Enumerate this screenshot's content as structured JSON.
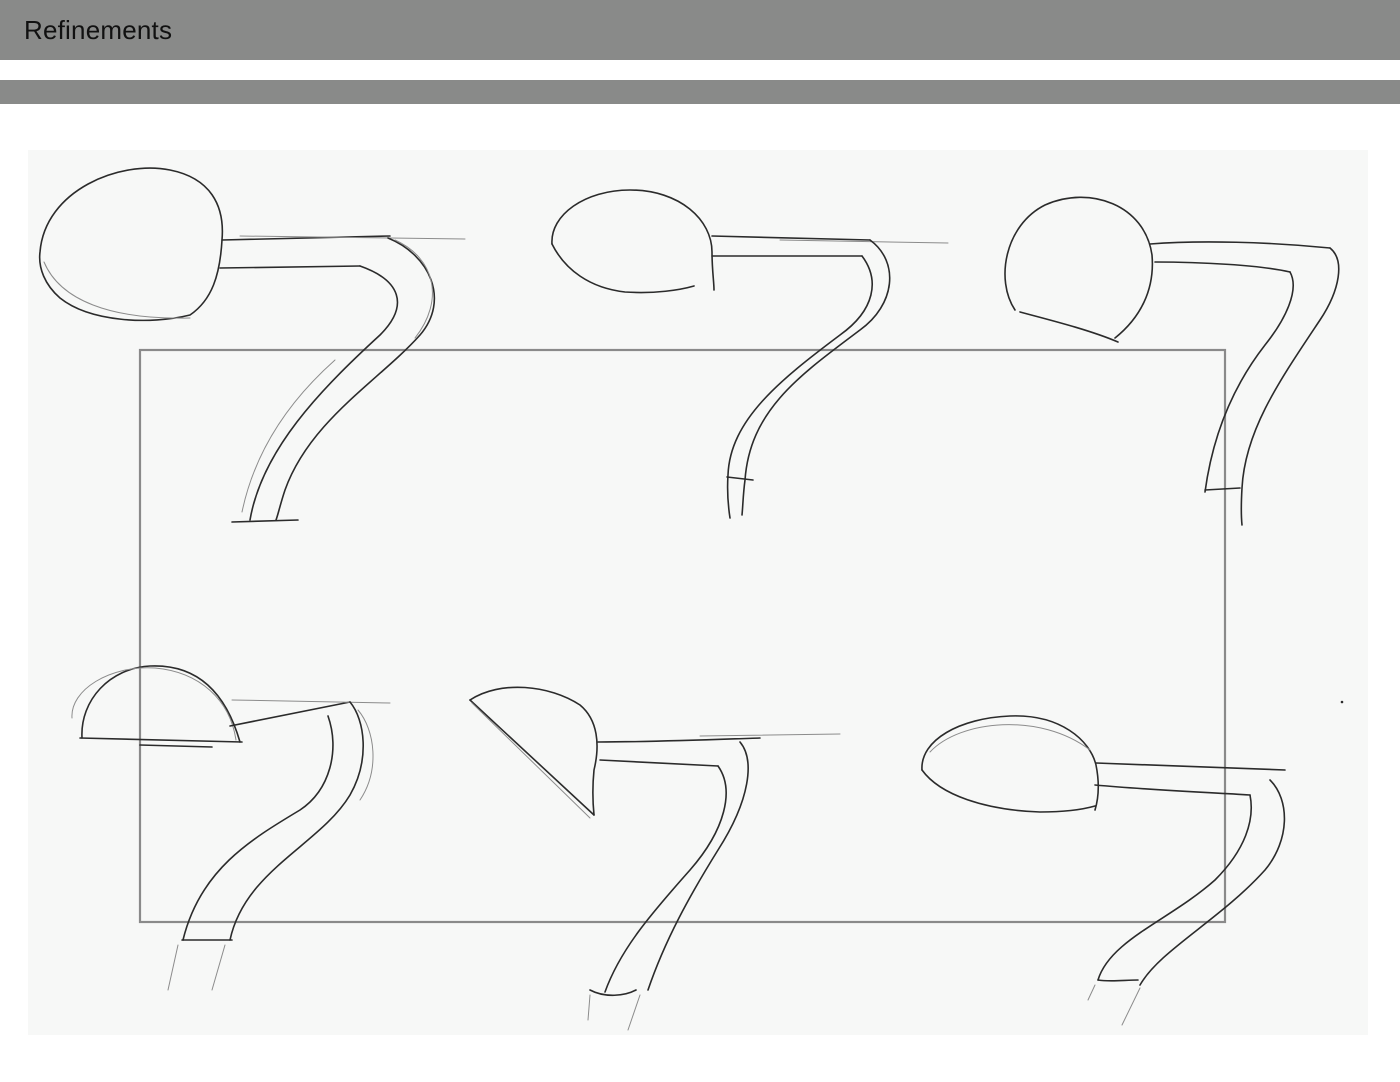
{
  "header": {
    "title": "Refinements"
  },
  "sketch": {
    "lamp_concepts": 6,
    "ink_color": "#2b2b2b",
    "frame_color": "#8a8a8a",
    "bar_color": "#898a89"
  }
}
